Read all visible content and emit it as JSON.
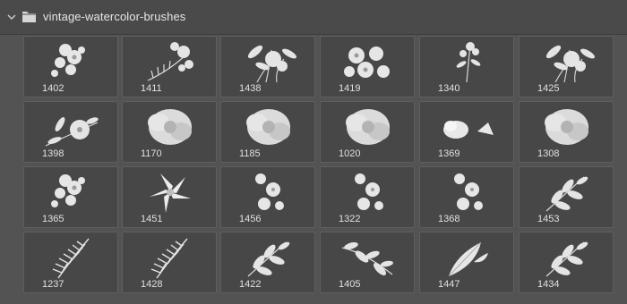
{
  "panel": {
    "folder_name": "vintage-watercolor-brushes",
    "icons": {
      "collapse": "chevron-down-icon",
      "folder": "folder-icon"
    }
  },
  "brushes": [
    {
      "id": "1402",
      "kind": "spray"
    },
    {
      "id": "1411",
      "kind": "fern-flowers"
    },
    {
      "id": "1438",
      "kind": "bouquet"
    },
    {
      "id": "1419",
      "kind": "petals"
    },
    {
      "id": "1340",
      "kind": "stem"
    },
    {
      "id": "1425",
      "kind": "bouquet"
    },
    {
      "id": "1398",
      "kind": "branch-flower"
    },
    {
      "id": "1170",
      "kind": "peony"
    },
    {
      "id": "1185",
      "kind": "peony"
    },
    {
      "id": "1020",
      "kind": "peony"
    },
    {
      "id": "1369",
      "kind": "two-buds"
    },
    {
      "id": "1308",
      "kind": "peony"
    },
    {
      "id": "1365",
      "kind": "spray"
    },
    {
      "id": "1451",
      "kind": "lily"
    },
    {
      "id": "1456",
      "kind": "small-blossoms"
    },
    {
      "id": "1322",
      "kind": "small-blossoms"
    },
    {
      "id": "1368",
      "kind": "small-blossoms"
    },
    {
      "id": "1453",
      "kind": "leaves"
    },
    {
      "id": "1237",
      "kind": "fern"
    },
    {
      "id": "1428",
      "kind": "fern"
    },
    {
      "id": "1422",
      "kind": "leaves"
    },
    {
      "id": "1405",
      "kind": "branch"
    },
    {
      "id": "1447",
      "kind": "leaf"
    },
    {
      "id": "1434",
      "kind": "leaves"
    }
  ]
}
